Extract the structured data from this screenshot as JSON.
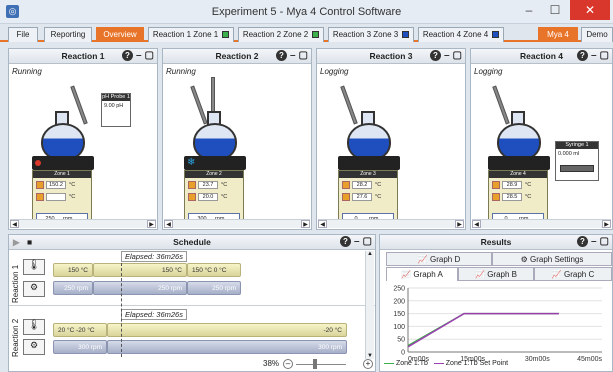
{
  "window": {
    "title": "Experiment 5 - Mya 4 Control Software"
  },
  "tabs": [
    {
      "label": "File"
    },
    {
      "label": "Reporting"
    },
    {
      "label": "Overview"
    },
    {
      "label": "Reaction 1 Zone 1"
    },
    {
      "label": "Reaction 2 Zone 2"
    },
    {
      "label": "Reaction 3 Zone 3"
    },
    {
      "label": "Reaction 4 Zone 4"
    }
  ],
  "right_tabs": {
    "mya4": "Mya 4",
    "demo": "Demo"
  },
  "reactions": [
    {
      "title": "Reaction 1",
      "status": "Running",
      "zone": "Zone 1",
      "temp1": "150.2",
      "temp2": "",
      "unit": "°C",
      "rpm": "250",
      "rpm_unit": "rpm",
      "side": {
        "title": "pH Probe 1",
        "value": "9.00",
        "unit": "pH"
      }
    },
    {
      "title": "Reaction 2",
      "status": "Running",
      "zone": "Zone 2",
      "temp1": "23.7",
      "temp2": "20.0",
      "unit": "°C",
      "rpm": "300",
      "rpm_unit": "rpm"
    },
    {
      "title": "Reaction 3",
      "status": "Logging",
      "zone": "Zone 3",
      "temp1": "28.2",
      "temp2": "27.6",
      "unit": "°C",
      "rpm": "0",
      "rpm_unit": "rpm"
    },
    {
      "title": "Reaction 4",
      "status": "Logging",
      "zone": "Zone 4",
      "temp1": "28.9",
      "temp2": "28.5",
      "unit": "°C",
      "rpm": "0",
      "rpm_unit": "rpm",
      "side": {
        "title": "Syringe 1",
        "value": "0.000",
        "unit": "ml"
      }
    }
  ],
  "schedule": {
    "title": "Schedule",
    "zoom": "38%",
    "rows": [
      {
        "label": "Reaction 1",
        "elapsed": "Elapsed: 36m26s",
        "temp_bars": [
          {
            "text": "150 °C",
            "align": "right"
          },
          {
            "text": "150 °C",
            "align": "right"
          },
          {
            "text": "150 °C    0 °C",
            "align": "left"
          }
        ],
        "rpm_bars": [
          {
            "text": "250 rpm"
          },
          {
            "text": "250 rpm"
          },
          {
            "text": "250 rpm"
          }
        ]
      },
      {
        "label": "Reaction 2",
        "elapsed": "Elapsed: 36m26s",
        "temp_bars": [
          {
            "text": "20 °C   -20 °C",
            "align": "left"
          },
          {
            "text": "-20 °C",
            "align": "right"
          }
        ],
        "rpm_bars": [
          {
            "text": "300 rpm"
          },
          {
            "text": "300 rpm"
          }
        ]
      }
    ]
  },
  "results": {
    "title": "Results",
    "tabs_row1": [
      {
        "label": "Graph D"
      },
      {
        "label": "Graph Settings"
      }
    ],
    "tabs_row2": [
      {
        "label": "Graph A"
      },
      {
        "label": "Graph B"
      },
      {
        "label": "Graph C"
      }
    ],
    "legend": [
      "Zone 1:Tb",
      "Zone 1:Tb Set Point"
    ],
    "colors": {
      "series1": "#3cb04a",
      "series2": "#9b3fb0"
    }
  },
  "chart_data": {
    "type": "line",
    "xlabel": "",
    "ylabel": "",
    "xticks": [
      "0m00s",
      "15m00s",
      "30m00s",
      "45m00s"
    ],
    "yticks": [
      0,
      50,
      100,
      150,
      200,
      250
    ],
    "xlim": [
      0,
      45
    ],
    "ylim": [
      0,
      250
    ],
    "series": [
      {
        "name": "Zone 1:Tb",
        "x": [
          0,
          13,
          35
        ],
        "y": [
          25,
          150,
          150
        ]
      },
      {
        "name": "Zone 1:Tb Set Point",
        "x": [
          0,
          13,
          35
        ],
        "y": [
          20,
          150,
          150
        ]
      }
    ]
  }
}
